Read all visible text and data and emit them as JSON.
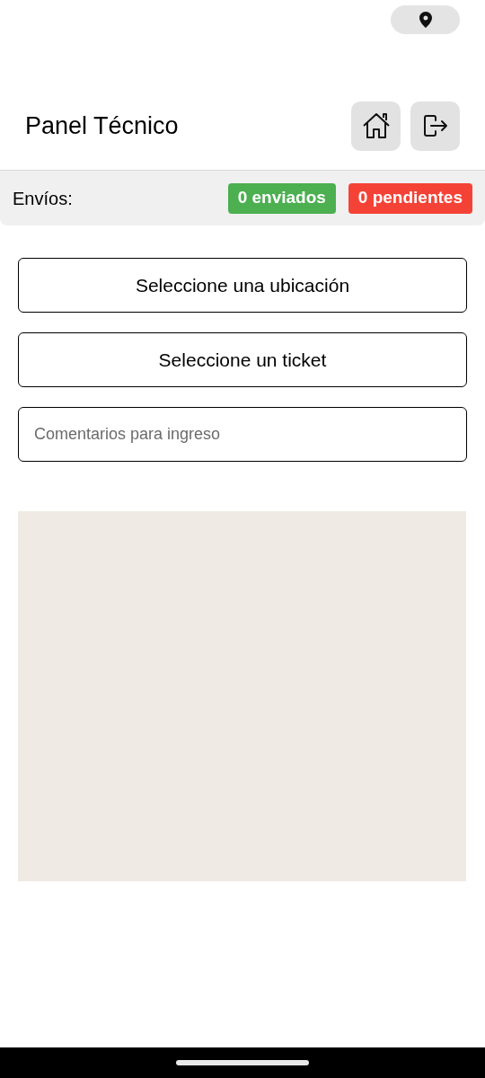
{
  "header": {
    "title": "Panel Técnico"
  },
  "shipments": {
    "label": "Envíos:",
    "counters": [
      {
        "text": "0 enviados",
        "color": "#4caf50"
      },
      {
        "text": "0 pendientes",
        "color": "#f44336"
      }
    ]
  },
  "selectors": [
    {
      "label": "Seleccione una ubicación"
    },
    {
      "label": "Seleccione un ticket"
    }
  ],
  "comments": {
    "placeholder": "Comentarios para ingreso"
  }
}
